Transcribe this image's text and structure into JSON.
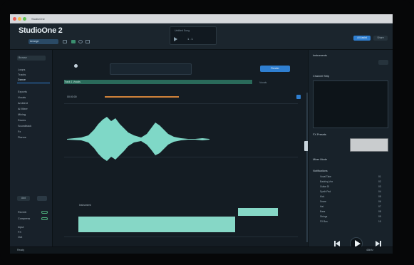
{
  "app": {
    "title": "StudioOne 2"
  },
  "menubar": {
    "title": "StudioOne"
  },
  "toolbar": {
    "workspace": "Arrange",
    "song_field": "Untitled Song",
    "position": "1 . 1",
    "right_button_1": "AI Assist",
    "right_button_2": "Share"
  },
  "sidebar": {
    "dropdown": "Browse",
    "items": [
      {
        "label": "Loops"
      },
      {
        "label": "Tracks"
      },
      {
        "label": "Dance"
      },
      {
        "label": "Exports"
      },
      {
        "label": "Vocals"
      },
      {
        "label": "Ambient"
      },
      {
        "label": "Ai Mixer"
      },
      {
        "label": "Mixing"
      },
      {
        "label": "Drums"
      },
      {
        "label": "Soundtrack"
      },
      {
        "label": "Fx"
      },
      {
        "label": "Pianos"
      }
    ],
    "bottom": {
      "button": "Add",
      "opt1": "Reverb",
      "opt2": "Compress",
      "list": [
        "Input",
        "FX",
        "Out"
      ]
    }
  },
  "main": {
    "topbar_button": "Render",
    "track_header": "Track 1 Vocals",
    "track_time": "00:00:00",
    "bottom_track": "Instrument",
    "mid_chip": "Vocals"
  },
  "right": {
    "section1": "Instruments",
    "section2": "Channel Strip",
    "section3": "FX Presets",
    "section4": "Mixer Mode",
    "section5": "Notifications",
    "list_items": [
      {
        "label": "Vocal Take",
        "num": "01"
      },
      {
        "label": "Backing Vox",
        "num": "02"
      },
      {
        "label": "Guitar DI",
        "num": "03"
      },
      {
        "label": "Synth Pad",
        "num": "04"
      },
      {
        "label": "Kick",
        "num": "05"
      },
      {
        "label": "Snare",
        "num": "06"
      },
      {
        "label": "Hat",
        "num": "07"
      },
      {
        "label": "Bass",
        "num": "08"
      },
      {
        "label": "Strings",
        "num": "09"
      },
      {
        "label": "FX Bus",
        "num": "10"
      }
    ]
  },
  "status": {
    "left": "Ready",
    "right": "48kHz"
  },
  "colors": {
    "accent": "#2f7fd1",
    "wave": "#7fd8c7",
    "bg": "#141b21"
  }
}
